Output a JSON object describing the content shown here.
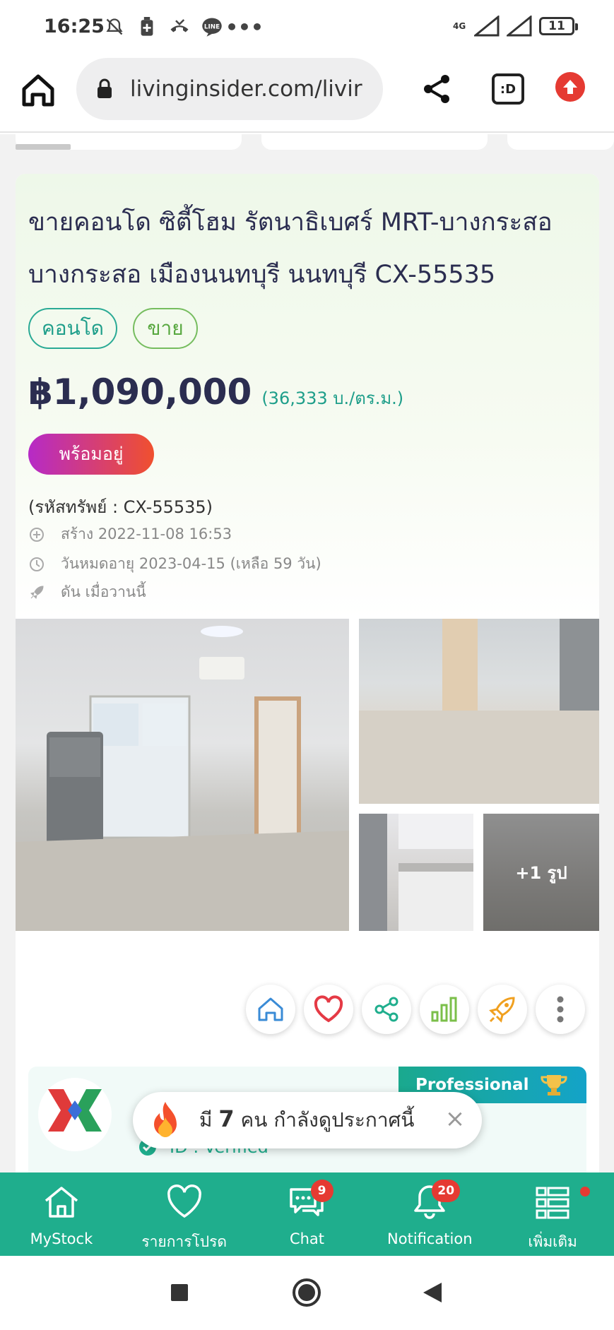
{
  "status_bar": {
    "time": "16:25",
    "network": "4G",
    "battery": "11"
  },
  "browser": {
    "url": "livinginsider.com/livir",
    "tabs_label": ":D"
  },
  "listing": {
    "title": "ขายคอนโด ซิตี้โฮม รัตนาธิเบศร์ MRT-บางกระสอ บางกระสอ เมืองนนทบุรี นนทบุรี CX-55535",
    "tags": [
      "คอนโด",
      "ขาย"
    ],
    "price": "฿1,090,000",
    "price_per_sqm": "(36,333 บ./ตร.ม.)",
    "status_badge": "พร้อมอยู่",
    "asset_code": "(รหัสทรัพย์ : CX-55535)",
    "created": "สร้าง 2022-11-08 16:53",
    "expires": "วันหมดอายุ 2023-04-15  (เหลือ 59 วัน)",
    "boosted": "ดัน เมื่อวานนี้",
    "more_photos": "+1 รูป"
  },
  "agent": {
    "badge": "Professional",
    "verified": "ID : Verified"
  },
  "toast": {
    "prefix": "มี",
    "count": "7",
    "suffix": "คน กำลังดูประกาศนี้",
    "close": "×"
  },
  "bottom_nav": [
    {
      "label": "MyStock",
      "icon": "home-outline-icon"
    },
    {
      "label": "รายการโปรด",
      "icon": "heart-outline-icon"
    },
    {
      "label": "Chat",
      "icon": "chat-icon",
      "badge": "9"
    },
    {
      "label": "Notification",
      "icon": "bell-icon",
      "badge": "20"
    },
    {
      "label": "เพิ่มเติม",
      "icon": "menu-list-icon"
    }
  ],
  "colors": {
    "brand_green": "#1fae8d",
    "title_navy": "#2b2d50",
    "badge_red": "#e53a32"
  }
}
